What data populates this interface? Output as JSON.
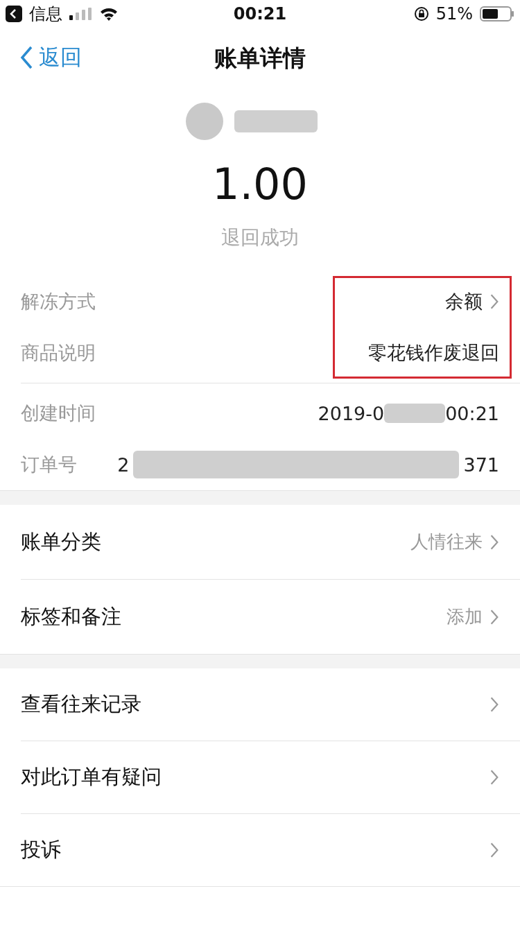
{
  "status_bar": {
    "back_app": "信息",
    "time": "00:21",
    "battery": "51%"
  },
  "nav": {
    "back": "返回",
    "title": "账单详情"
  },
  "header": {
    "amount": "1.00",
    "status": "退回成功"
  },
  "details": [
    {
      "label": "解冻方式",
      "value": "余额",
      "chevron": true
    },
    {
      "label": "商品说明",
      "value": "零花钱作废退回",
      "chevron": false
    }
  ],
  "info": [
    {
      "label": "创建时间",
      "value_start": "2019-0",
      "value_end": "00:21"
    },
    {
      "label": "订单号",
      "value_start": "2",
      "value_end": "371"
    }
  ],
  "menu_groups": [
    [
      {
        "label": "账单分类",
        "value": "人情往来"
      },
      {
        "label": "标签和备注",
        "value": "添加"
      }
    ],
    [
      {
        "label": "查看往来记录"
      },
      {
        "label": "对此订单有疑问"
      },
      {
        "label": "投诉"
      }
    ]
  ]
}
